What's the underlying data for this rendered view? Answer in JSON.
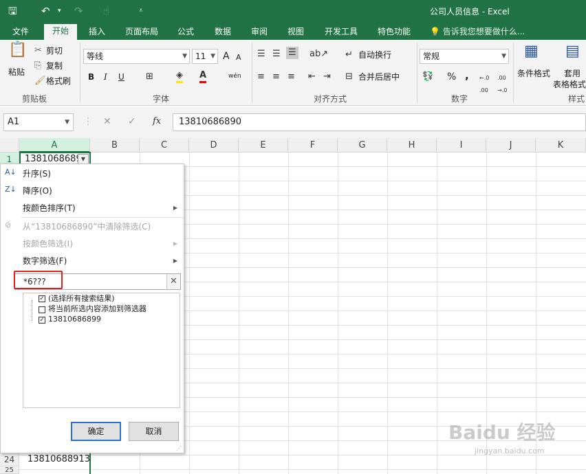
{
  "window": {
    "title": "公司人员信息 - Excel",
    "quick_access": [
      "save-icon",
      "undo-icon",
      "redo-icon",
      "touch-mode-icon",
      "customize-icon"
    ]
  },
  "ribbon_tabs": [
    "文件",
    "开始",
    "插入",
    "页面布局",
    "公式",
    "数据",
    "审阅",
    "视图",
    "开发工具",
    "特色功能"
  ],
  "active_tab": "开始",
  "tell_me": "告诉我您想要做什么...",
  "clipboard": {
    "paste": "粘贴",
    "cut": "剪切",
    "copy": "复制",
    "format_painter": "格式刷",
    "label": "剪贴板"
  },
  "font": {
    "name": "等线",
    "size": "11",
    "label": "字体",
    "bold": "B",
    "italic": "I",
    "underline": "U",
    "grow": "A",
    "shrink": "A",
    "phonetic": "wén"
  },
  "alignment": {
    "wrap": "自动换行",
    "merge": "合并后居中",
    "label": "对齐方式"
  },
  "number": {
    "format": "常规",
    "percent": "%",
    "comma": ",",
    "inc_decimal": ".0→.00",
    "dec_decimal": ".00→.0",
    "label": "数字"
  },
  "styles": {
    "conditional": "条件格式",
    "table1": "套用",
    "table2": "表格格式",
    "label": "样式"
  },
  "formula_bar": {
    "name_box": "A1",
    "fx": "fx",
    "value": "13810686890"
  },
  "columns": [
    "A",
    "B",
    "C",
    "D",
    "E",
    "F",
    "G",
    "H",
    "I",
    "J",
    "K"
  ],
  "rows": {
    "r1": "1",
    "r24": "24",
    "r25": "25"
  },
  "cells": {
    "a1": "13810686890",
    "a24": "13810688913"
  },
  "filter_menu": {
    "sort_asc": "升序(S)",
    "sort_desc": "降序(O)",
    "sort_by_color": "按颜色排序(T)",
    "clear_filter": "从“13810686890”中清除筛选(C)",
    "filter_by_color": "按颜色筛选(I)",
    "number_filters": "数字筛选(F)",
    "search_value": "*6???",
    "items": [
      {
        "label": "(选择所有搜索结果)",
        "checked": true
      },
      {
        "label": "将当前所选内容添加到筛选器",
        "checked": false
      },
      {
        "label": "13810686899",
        "checked": true
      }
    ],
    "ok": "确定",
    "cancel": "取消"
  },
  "watermark": {
    "logo": "Baidu 经验",
    "url": "jingyan.baidu.com"
  },
  "colors": {
    "accent": "#217346",
    "highlight": "#e02020"
  }
}
